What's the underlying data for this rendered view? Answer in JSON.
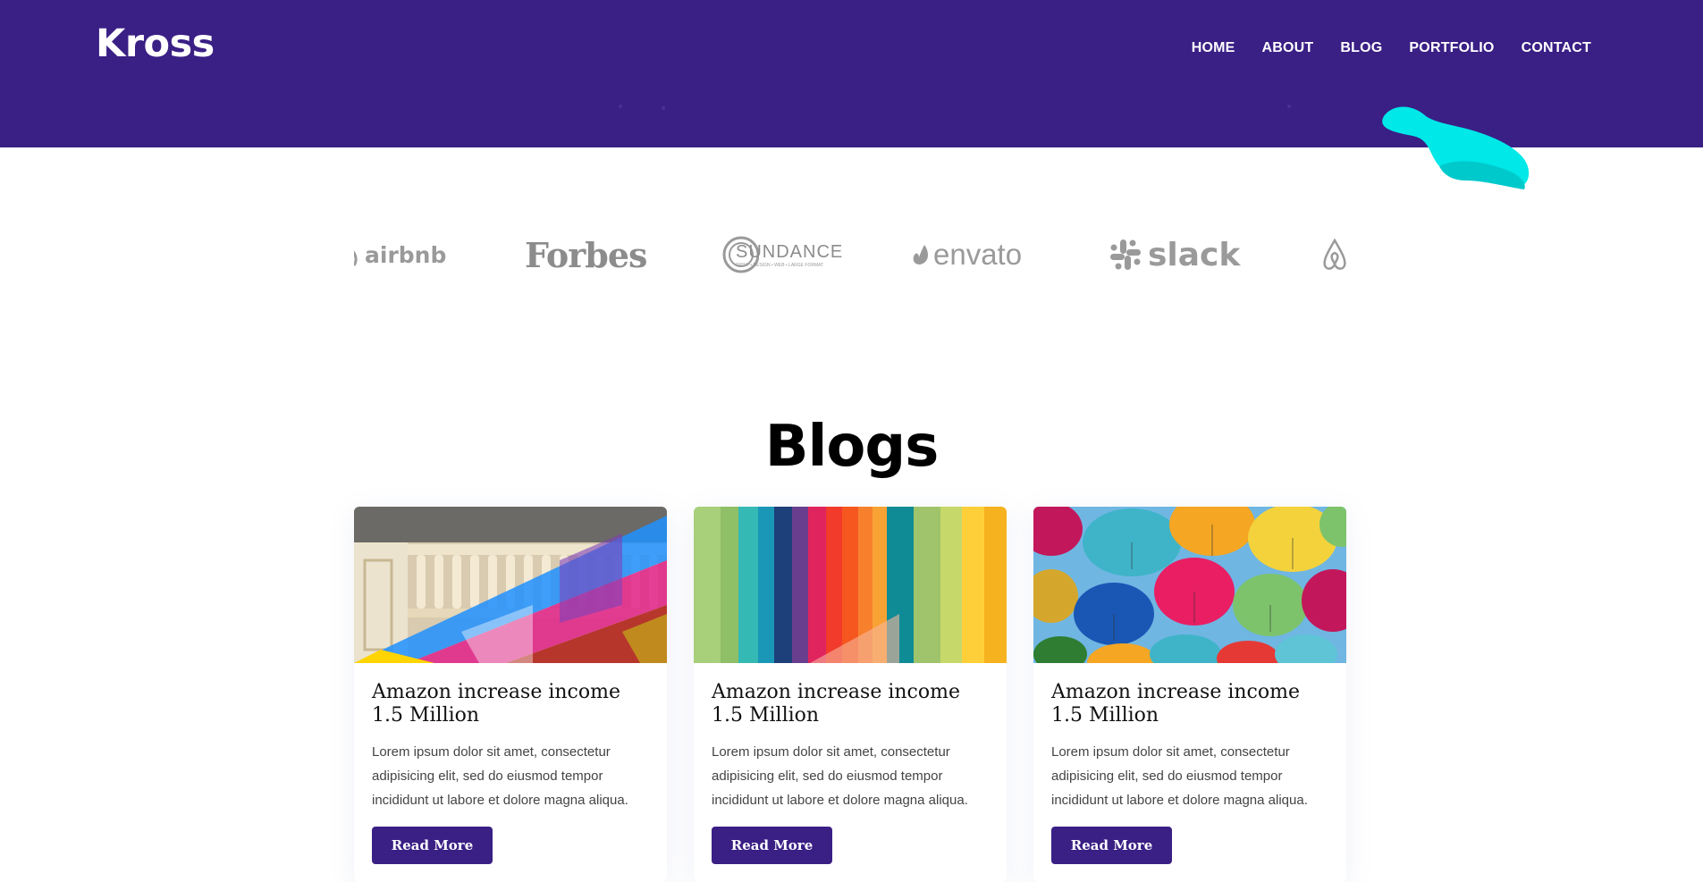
{
  "site": {
    "logo": "Kross"
  },
  "nav": {
    "items": [
      {
        "label": "HOME"
      },
      {
        "label": "ABOUT"
      },
      {
        "label": "BLOG"
      },
      {
        "label": "PORTFOLIO"
      },
      {
        "label": "CONTACT"
      }
    ]
  },
  "clients": {
    "logos": [
      {
        "name": "airbnb",
        "text": "airbnb",
        "icon": "airbnb-icon"
      },
      {
        "name": "forbes",
        "text": "Forbes"
      },
      {
        "name": "sundance",
        "text": "SUNDANCE",
        "subtext": "PRINT • DESIGN • WEB • LARGE FORMAT"
      },
      {
        "name": "envato",
        "text": "envato",
        "icon": "envato-leaf-icon"
      },
      {
        "name": "slack",
        "text": "slack",
        "icon": "slack-icon"
      },
      {
        "name": "airbnb-2",
        "text": "",
        "icon": "airbnb-icon"
      }
    ]
  },
  "blogs": {
    "title": "Blogs",
    "posts": [
      {
        "title": "Amazon increase income 1.5 Million",
        "excerpt": "Lorem ipsum dolor sit amet, consectetur adipisicing elit, sed do eiusmod tempor incididunt ut labore et dolore magna aliqua.",
        "button": "Read More",
        "image": "rainbow-railing-photo"
      },
      {
        "title": "Amazon increase income 1.5 Million",
        "excerpt": "Lorem ipsum dolor sit amet, consectetur adipisicing elit, sed do eiusmod tempor incididunt ut labore et dolore magna aliqua.",
        "button": "Read More",
        "image": "colorful-columns-photo"
      },
      {
        "title": "Amazon increase income 1.5 Million",
        "excerpt": "Lorem ipsum dolor sit amet, consectetur adipisicing elit, sed do eiusmod tempor incididunt ut labore et dolore magna aliqua.",
        "button": "Read More",
        "image": "umbrellas-photo"
      }
    ]
  },
  "colors": {
    "brand": "#3a1f85",
    "accent": "#00e5e5",
    "logo_gray": "#9a9a9a"
  }
}
